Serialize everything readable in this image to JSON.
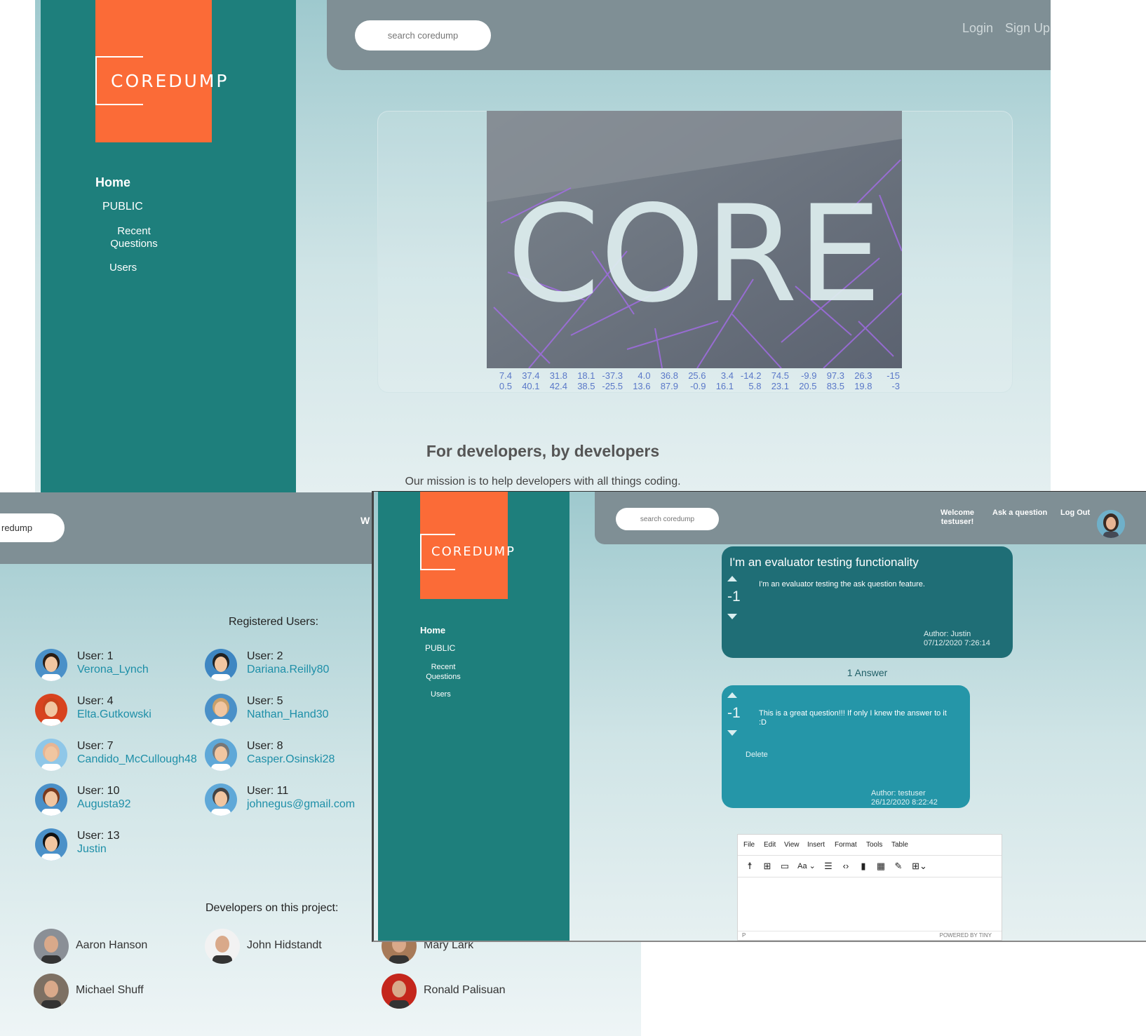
{
  "home": {
    "logo": {
      "text": "COREDUMP",
      "bg_color": "#fb6b37"
    },
    "nav": {
      "home": "Home",
      "public": "PUBLIC",
      "recent": "Recent Questions",
      "users": "Users"
    },
    "search_placeholder": "search coredump",
    "login": "Login",
    "signup": "Sign Up",
    "hero": {
      "word": "CORE",
      "numbers_row1": [
        "7.4",
        "37.4",
        "31.8",
        "18.1",
        "-37.3",
        "4.0",
        "36.8",
        "25.6",
        "3.4",
        "-14.2",
        "74.5",
        "-9.9",
        "97.3",
        "26.3",
        "-15"
      ],
      "numbers_row2": [
        "0.5",
        "40.1",
        "42.4",
        "38.5",
        "-25.5",
        "13.6",
        "87.9",
        "-0.9",
        "16.1",
        "5.8",
        "23.1",
        "20.5",
        "83.5",
        "19.8",
        "-3"
      ]
    },
    "tagline": "For developers, by developers",
    "mission": "Our mission is to help developers with all things coding."
  },
  "users_page": {
    "search_value": "redump",
    "welcome_partial": "W te",
    "registered_title": "Registered Users:",
    "users": [
      {
        "id": "User: 1",
        "name": "Verona_Lynch",
        "avatar": "woman-dark-hair-icon"
      },
      {
        "id": "User: 2",
        "name": "Dariana.Reilly80",
        "avatar": "man-sunglasses-icon"
      },
      {
        "id": "User: 4",
        "name": "Elta.Gutkowski",
        "avatar": "woman-red-hair-icon"
      },
      {
        "id": "User: 5",
        "name": "Nathan_Hand30",
        "avatar": "man-sunglasses-blond-icon"
      },
      {
        "id": "User: 7",
        "name": "Candido_McCullough48",
        "avatar": "bald-man-icon"
      },
      {
        "id": "User: 8",
        "name": "Casper.Osinski28",
        "avatar": "old-man-sunglasses-icon"
      },
      {
        "id": "User: 10",
        "name": "Augusta92",
        "avatar": "bearded-man-icon"
      },
      {
        "id": "User: 11",
        "name": "johnegus@gmail.com",
        "avatar": "man-glasses-beard-icon"
      },
      {
        "id": "User: 13",
        "name": "Justin",
        "avatar": "man-sunglasses-suit-icon"
      }
    ],
    "developers_title": "Developers on this project:",
    "developers": [
      {
        "name": "Aaron Hanson"
      },
      {
        "name": "John Hidstandt"
      },
      {
        "name": "Mary Lark"
      },
      {
        "name": "Michael Shuff"
      },
      {
        "name": "Ronald Palisuan"
      }
    ]
  },
  "question_page": {
    "logo_text": "COREDUMP",
    "nav": {
      "home": "Home",
      "public": "PUBLIC",
      "recent": "Recent Questions",
      "users": "Users"
    },
    "search_placeholder": "search coredump",
    "welcome": "Welcome testuser!",
    "ask": "Ask a question",
    "logout": "Log Out",
    "question": {
      "title": "I'm an evaluator testing functionality",
      "votes": "-1",
      "body": "I'm an evaluator testing the ask question feature.",
      "author": "Author: Justin",
      "date": "07/12/2020 7:26:14"
    },
    "answer_count": "1 Answer",
    "answer": {
      "votes": "-1",
      "body": "This is a great question!!! If only I knew the answer to it  :D",
      "delete": "Delete",
      "author": "Author: testuser",
      "date": "26/12/2020 8:22:42"
    },
    "editor": {
      "menu": [
        "File",
        "Edit",
        "View",
        "Insert",
        "Format",
        "Tools",
        "Table"
      ],
      "status_left": "P",
      "status_right": "POWERED BY TINY"
    }
  }
}
